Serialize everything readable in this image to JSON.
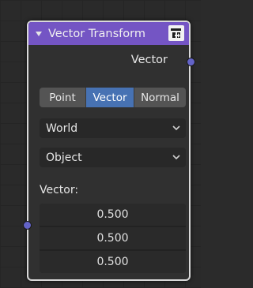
{
  "node": {
    "title": "Vector Transform",
    "header_color": "#7455c4",
    "header_icons": [
      "collapse-triangle",
      "preview-toggle-icon"
    ],
    "output": {
      "label": "Vector",
      "socket_color": "#6363c7"
    },
    "type_selector": {
      "options": [
        "Point",
        "Vector",
        "Normal"
      ],
      "selected": "Vector",
      "active_color": "#4772b3"
    },
    "convert_from": {
      "value": "World"
    },
    "convert_to": {
      "value": "Object"
    },
    "input": {
      "label": "Vector:",
      "socket_color": "#6363c7",
      "values": [
        "0.500",
        "0.500",
        "0.500"
      ]
    }
  }
}
